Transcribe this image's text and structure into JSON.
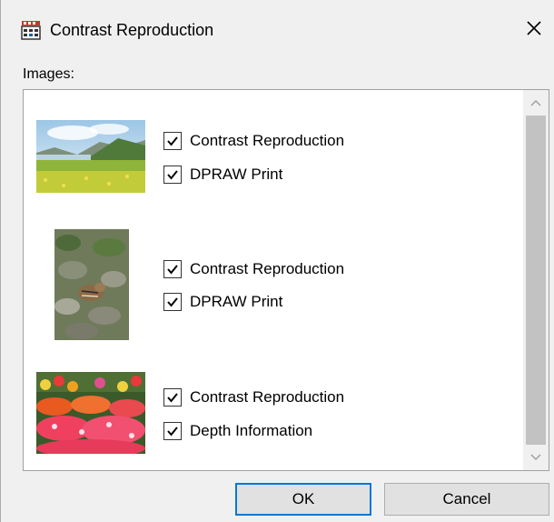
{
  "window": {
    "title": "Contrast Reproduction",
    "icon": "printer-app-icon",
    "close_icon": "close-icon"
  },
  "images_label": "Images:",
  "images": [
    {
      "thumbnail": "landscape-meadow-mountains",
      "options": [
        {
          "label": "Contrast Reproduction",
          "checked": true
        },
        {
          "label": "DPRAW Print",
          "checked": true
        }
      ]
    },
    {
      "thumbnail": "chipmunk-on-rocks",
      "options": [
        {
          "label": "Contrast Reproduction",
          "checked": true
        },
        {
          "label": "DPRAW Print",
          "checked": true
        }
      ]
    },
    {
      "thumbnail": "flower-beds",
      "options": [
        {
          "label": "Contrast Reproduction",
          "checked": true
        },
        {
          "label": "Depth Information",
          "checked": true
        }
      ]
    }
  ],
  "buttons": {
    "ok": "OK",
    "cancel": "Cancel"
  },
  "colors": {
    "dialog_bg": "#f0f0f0",
    "list_bg": "#ffffff",
    "default_button_border": "#0078d7"
  }
}
